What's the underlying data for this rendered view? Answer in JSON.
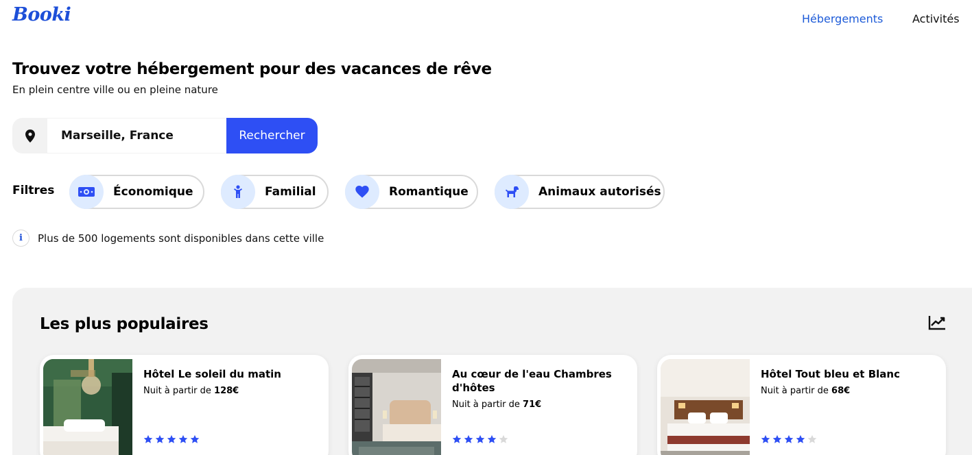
{
  "header": {
    "logo": "Booki",
    "nav": [
      {
        "label": "Hébergements",
        "active": true
      },
      {
        "label": "Activités",
        "active": false
      }
    ]
  },
  "hero": {
    "title": "Trouvez votre hébergement pour des vacances de rêve",
    "subtitle": "En plein centre ville ou en pleine nature"
  },
  "search": {
    "icon": "map-pin-icon",
    "value": "Marseille, France",
    "button_label": "Rechercher"
  },
  "filters": {
    "label": "Filtres",
    "items": [
      {
        "label": "Économique",
        "icon": "money-icon"
      },
      {
        "label": "Familial",
        "icon": "child-icon"
      },
      {
        "label": "Romantique",
        "icon": "heart-icon"
      },
      {
        "label": "Animaux autorisés",
        "icon": "dog-icon"
      }
    ]
  },
  "info": {
    "icon": "info-icon",
    "text": "Plus de 500 logements sont disponibles dans cette ville"
  },
  "popular": {
    "title": "Les plus populaires",
    "icon": "trend-chart-icon",
    "price_prefix": "Nuit à partir de",
    "cards": [
      {
        "name": "Hôtel Le soleil du matin",
        "price": "128€",
        "rating": 5
      },
      {
        "name": "Au cœur de l'eau Chambres d'hôtes",
        "price": "71€",
        "rating": 4
      },
      {
        "name": "Hôtel Tout bleu et Blanc",
        "price": "68€",
        "rating": 4
      }
    ]
  },
  "colors": {
    "accent": "#2e4ff4",
    "link_active": "#1d5bd8",
    "icon_bg": "#deebff",
    "section_bg": "#f2f2f2",
    "star_empty": "#d9d9d9"
  }
}
